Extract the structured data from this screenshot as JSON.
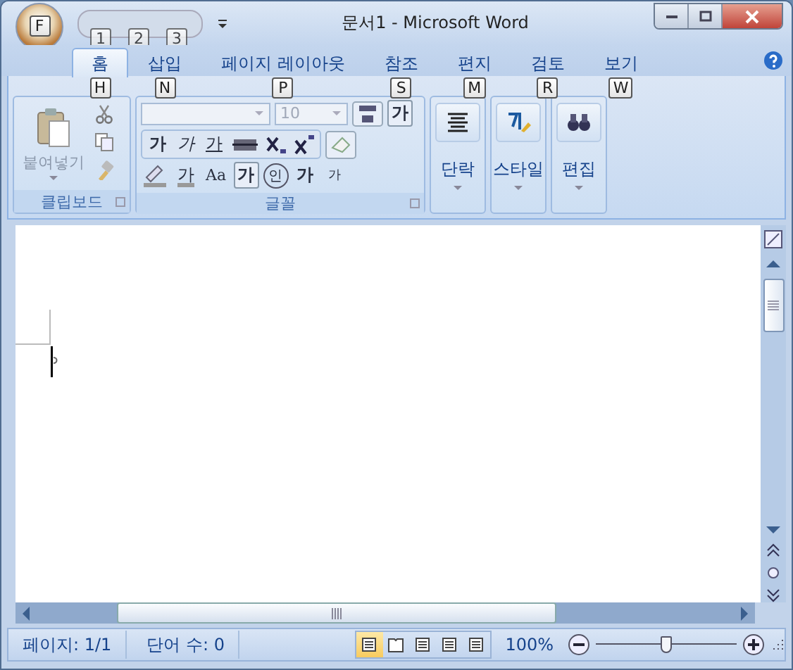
{
  "window": {
    "title": "문서1 - Microsoft Word",
    "office_keytip": "F"
  },
  "quick_access": {
    "keytips": [
      "1",
      "2",
      "3"
    ]
  },
  "tabs": [
    {
      "label": "홈",
      "keytip": "H",
      "selected": true
    },
    {
      "label": "삽입",
      "keytip": "N",
      "selected": false
    },
    {
      "label": "페이지 레이아웃",
      "keytip": "P",
      "selected": false
    },
    {
      "label": "참조",
      "keytip": "S",
      "selected": false
    },
    {
      "label": "편지",
      "keytip": "M",
      "selected": false
    },
    {
      "label": "검토",
      "keytip": "R",
      "selected": false
    },
    {
      "label": "보기",
      "keytip": "W",
      "selected": false
    }
  ],
  "clipboard": {
    "label": "클립보드",
    "paste": "붙여넣기"
  },
  "font": {
    "label": "글꼴",
    "size": "10",
    "row1": [
      {
        "kind": "bold",
        "text": "가"
      },
      {
        "kind": "italic",
        "text": "가"
      },
      {
        "kind": "underline",
        "text": "가"
      }
    ],
    "row2": [
      {
        "kind": "color",
        "text": "가"
      },
      {
        "kind": "case",
        "text": "Aa"
      },
      {
        "kind": "border",
        "text": "가"
      },
      {
        "kind": "circle",
        "text": "인"
      },
      {
        "kind": "grow",
        "text": "가"
      },
      {
        "kind": "shrink",
        "text": "가"
      }
    ],
    "border_glyph": "가"
  },
  "big_groups": [
    {
      "kind": "paragraph",
      "label": "단락"
    },
    {
      "kind": "styles",
      "label": "스타일"
    },
    {
      "kind": "editing",
      "label": "편집"
    }
  ],
  "status_bar": {
    "page": "페이지: 1/1",
    "words": "단어 수: 0",
    "zoom": "100%",
    "level": 0.5,
    "views": [
      {
        "selected": true
      },
      {
        "selected": false
      },
      {
        "selected": false
      },
      {
        "selected": false
      },
      {
        "selected": false
      }
    ]
  }
}
